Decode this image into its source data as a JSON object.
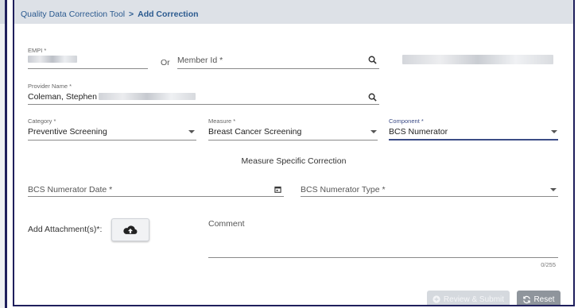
{
  "breadcrumb": {
    "root": "Quality Data Correction Tool",
    "separator": ">",
    "current": "Add Correction"
  },
  "form": {
    "empi": {
      "label": "EMPI *",
      "value": ""
    },
    "or_text": "Or",
    "member_id": {
      "placeholder": "Member Id *"
    },
    "provider": {
      "label": "Provider Name *",
      "value": "Coleman, Stephen"
    },
    "category": {
      "label": "Category *",
      "value": "Preventive Screening"
    },
    "measure": {
      "label": "Measure *",
      "value": "Breast Cancer Screening"
    },
    "component": {
      "label": "Component *",
      "value": "BCS Numerator"
    },
    "section_title": "Measure Specific Correction",
    "numerator_date": {
      "placeholder": "BCS Numerator Date *"
    },
    "numerator_type": {
      "placeholder": "BCS Numerator Type *"
    },
    "attachment_label": "Add Attachment(s)*:",
    "comment": {
      "placeholder": "Comment",
      "counter": "0/255"
    }
  },
  "actions": {
    "review_submit": "Review & Submit",
    "reset": "Reset"
  },
  "icons": [
    "search-icon",
    "calendar-icon",
    "cloud-upload-icon",
    "plus-circle-icon",
    "refresh-icon",
    "dropdown-arrow-icon"
  ],
  "colors": {
    "header_bg": "#dde1e7",
    "accent_link": "#2b5a8f",
    "frame": "#1f1f5c",
    "component_underline": "#3c4c86"
  }
}
